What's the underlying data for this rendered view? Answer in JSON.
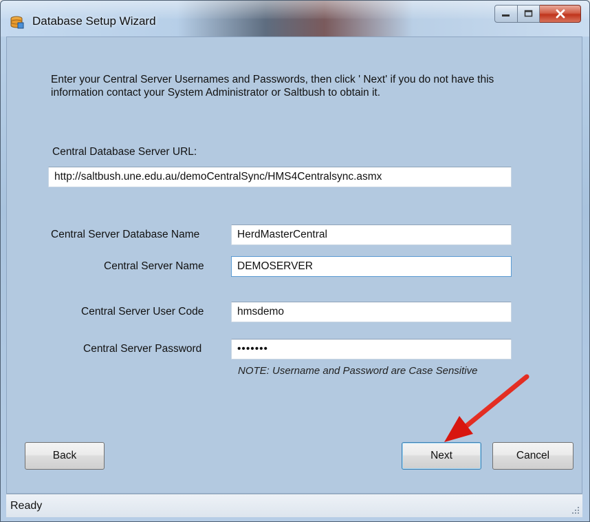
{
  "window": {
    "title": "Database Setup Wizard",
    "icons": {
      "app": "database-setup-icon",
      "minimize": "minimize-icon",
      "maximize": "maximize-icon",
      "close": "close-icon"
    }
  },
  "intro_text": "Enter your Central Server Usernames and Passwords, then click ' Next' if you do not have this information contact your System Administrator or Saltbush to obtain it.",
  "url": {
    "label": "Central Database Server URL:",
    "value": "http://saltbush.une.edu.au/demoCentralSync/HMS4Centralsync.asmx"
  },
  "db_name": {
    "label": "Central Server Database Name",
    "value": "HerdMasterCentral"
  },
  "server_name": {
    "label": "Central Server Name",
    "value": "DEMOSERVER"
  },
  "user_code": {
    "label": "Central Server User Code",
    "value": "hmsdemo"
  },
  "password": {
    "label": "Central Server Password",
    "value": "hmsdemo"
  },
  "note": "NOTE: Username and Password are Case Sensitive",
  "buttons": {
    "back": "Back",
    "next": "Next",
    "cancel": "Cancel"
  },
  "status": "Ready",
  "colors": {
    "annotation_arrow": "#e0201b",
    "client_bg": "#b3c9e0"
  }
}
